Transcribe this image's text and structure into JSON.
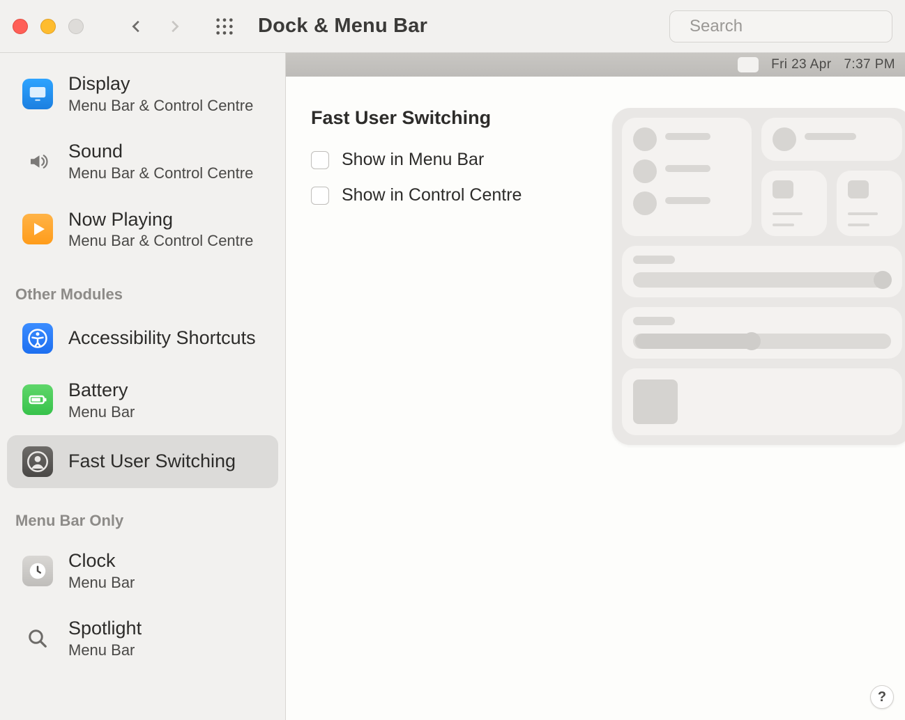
{
  "window": {
    "title": "Dock & Menu Bar",
    "search_placeholder": "Search"
  },
  "menubar_preview": {
    "date": "Fri 23 Apr",
    "time": "7:37 PM"
  },
  "sidebar": {
    "items_top": [
      {
        "title": "Display",
        "sub": "Menu Bar & Control Centre",
        "icon": "display"
      },
      {
        "title": "Sound",
        "sub": "Menu Bar & Control Centre",
        "icon": "sound"
      },
      {
        "title": "Now Playing",
        "sub": "Menu Bar & Control Centre",
        "icon": "playing"
      }
    ],
    "header_other": "Other Modules",
    "items_other": [
      {
        "title": "Accessibility Shortcuts",
        "sub": "",
        "icon": "access"
      },
      {
        "title": "Battery",
        "sub": "Menu Bar",
        "icon": "battery"
      },
      {
        "title": "Fast User Switching",
        "sub": "",
        "icon": "user",
        "selected": true
      }
    ],
    "header_menubar_only": "Menu Bar Only",
    "items_menubar_only": [
      {
        "title": "Clock",
        "sub": "Menu Bar",
        "icon": "clock"
      },
      {
        "title": "Spotlight",
        "sub": "Menu Bar",
        "icon": "spotlight"
      }
    ]
  },
  "main": {
    "section_title": "Fast User Switching",
    "checkboxes": [
      {
        "label": "Show in Menu Bar",
        "checked": false
      },
      {
        "label": "Show in Control Centre",
        "checked": false
      }
    ]
  },
  "help_label": "?"
}
